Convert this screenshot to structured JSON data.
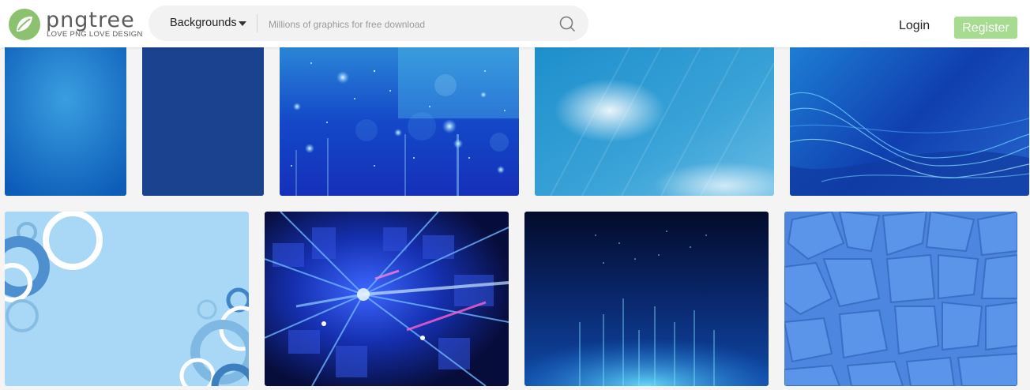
{
  "header": {
    "logo": {
      "name": "pngtree",
      "tagline": "LOVE PNG LOVE DESIGN"
    },
    "search": {
      "category": "Backgrounds",
      "placeholder": "Millions of graphics for free download"
    },
    "login_label": "Login",
    "register_label": "Register"
  },
  "colors": {
    "brand_green": "#8cc16f",
    "register_bg": "#a6dc8f",
    "page_bg": "#f4f4f4"
  },
  "gallery": {
    "row1": [
      {
        "name": "radial-blue-gradient"
      },
      {
        "name": "solid-navy-blue"
      },
      {
        "name": "blue-bokeh-lights"
      },
      {
        "name": "light-blue-streaks"
      },
      {
        "name": "blue-wave-lines"
      }
    ],
    "row2": [
      {
        "name": "light-blue-circles"
      },
      {
        "name": "blue-speed-light"
      },
      {
        "name": "dark-blue-stage-light"
      },
      {
        "name": "blue-cracked-tiles"
      }
    ]
  }
}
